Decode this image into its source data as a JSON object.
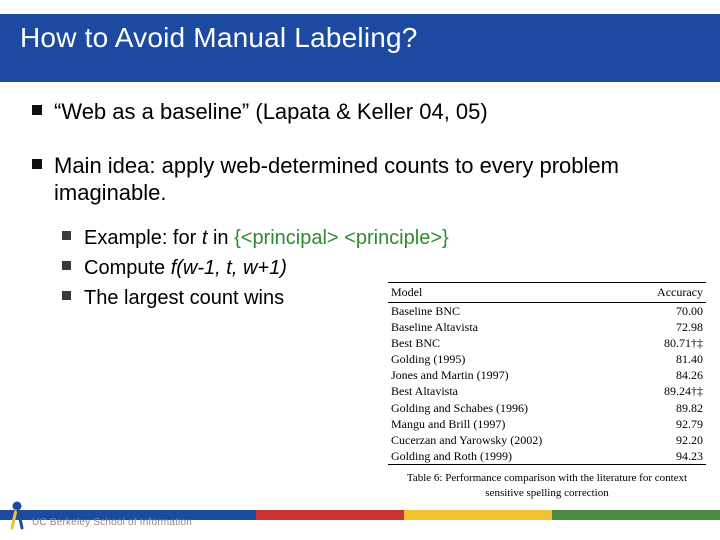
{
  "title": "How to Avoid Manual Labeling?",
  "bullets": {
    "b1_pre": "“Web as a baseline” (Lapata & Keller 04, 05)",
    "b2": "Main idea: apply web-determined counts to every problem imaginable.",
    "sub": {
      "s1_a": "Example:  for ",
      "s1_it": "t",
      "s1_b": " in ",
      "s1_green": "{<principal> <principle>}",
      "s2_a": "Compute ",
      "s2_it": "f(w-1, t, w+1)",
      "s3": "The largest count wins"
    }
  },
  "table": {
    "head": {
      "model": "Model",
      "acc": "Accuracy"
    },
    "rows": [
      {
        "model": "Baseline BNC",
        "acc": "70.00"
      },
      {
        "model": "Baseline Altavista",
        "acc": "72.98"
      },
      {
        "model": "Best BNC",
        "acc": "80.71†‡"
      },
      {
        "model": "Golding (1995)",
        "acc": "81.40"
      },
      {
        "model": "Jones and Martin (1997)",
        "acc": "84.26"
      },
      {
        "model": "Best Altavista",
        "acc": "89.24†‡"
      },
      {
        "model": "Golding and Schabes (1996)",
        "acc": "89.82"
      },
      {
        "model": "Mangu and Brill (1997)",
        "acc": "92.79"
      },
      {
        "model": "Cucerzan and Yarowsky (2002)",
        "acc": "92.20"
      },
      {
        "model": "Golding and Roth (1999)",
        "acc": "94.23"
      }
    ],
    "caption": "Table 6: Performance comparison with the literature for context sensitive spelling correction"
  },
  "footer": {
    "logo_text": "UC Berkeley School of Information"
  },
  "chart_data": {
    "type": "table",
    "title": "Table 6: Performance comparison with the literature for context sensitive spelling correction",
    "columns": [
      "Model",
      "Accuracy"
    ],
    "rows": [
      [
        "Baseline BNC",
        70.0
      ],
      [
        "Baseline Altavista",
        72.98
      ],
      [
        "Best BNC",
        80.71
      ],
      [
        "Golding (1995)",
        81.4
      ],
      [
        "Jones and Martin (1997)",
        84.26
      ],
      [
        "Best Altavista",
        89.24
      ],
      [
        "Golding and Schabes (1996)",
        89.82
      ],
      [
        "Mangu and Brill (1997)",
        92.79
      ],
      [
        "Cucerzan and Yarowsky (2002)",
        92.2
      ],
      [
        "Golding and Roth (1999)",
        94.23
      ]
    ]
  }
}
